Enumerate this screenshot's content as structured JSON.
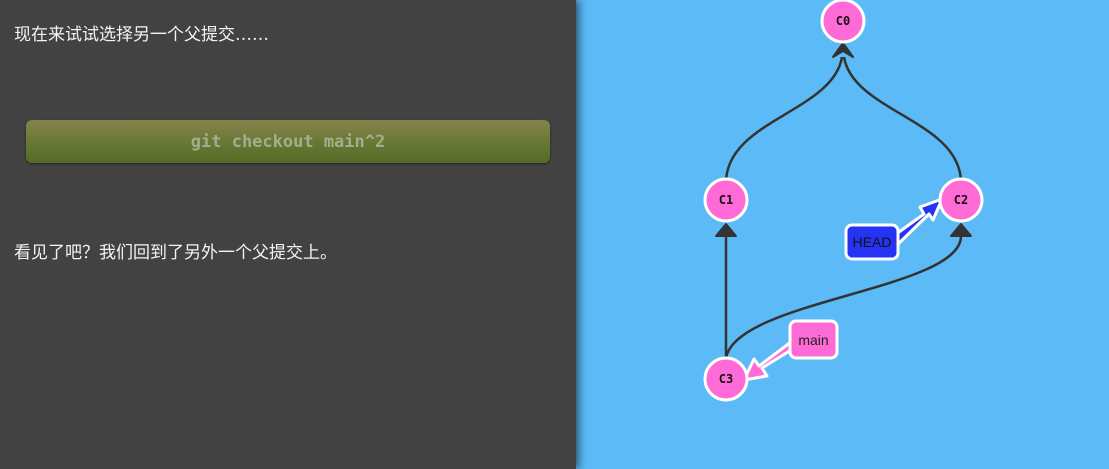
{
  "instructions": {
    "line1": "现在来试试选择另一个父提交……",
    "command": "git checkout main^2",
    "line2": "看见了吧？我们回到了另外一个父提交上。"
  },
  "graph": {
    "commits": [
      "C0",
      "C1",
      "C2",
      "C3"
    ],
    "branch": "main",
    "head": "HEAD"
  },
  "colors": {
    "left_bg": "#424242",
    "right_bg": "#5cbaf7",
    "commit_fill": "#ff6bd6",
    "head_fill": "#2633f2",
    "branch_fill": "#ff6bd6",
    "edge": "#333333"
  }
}
